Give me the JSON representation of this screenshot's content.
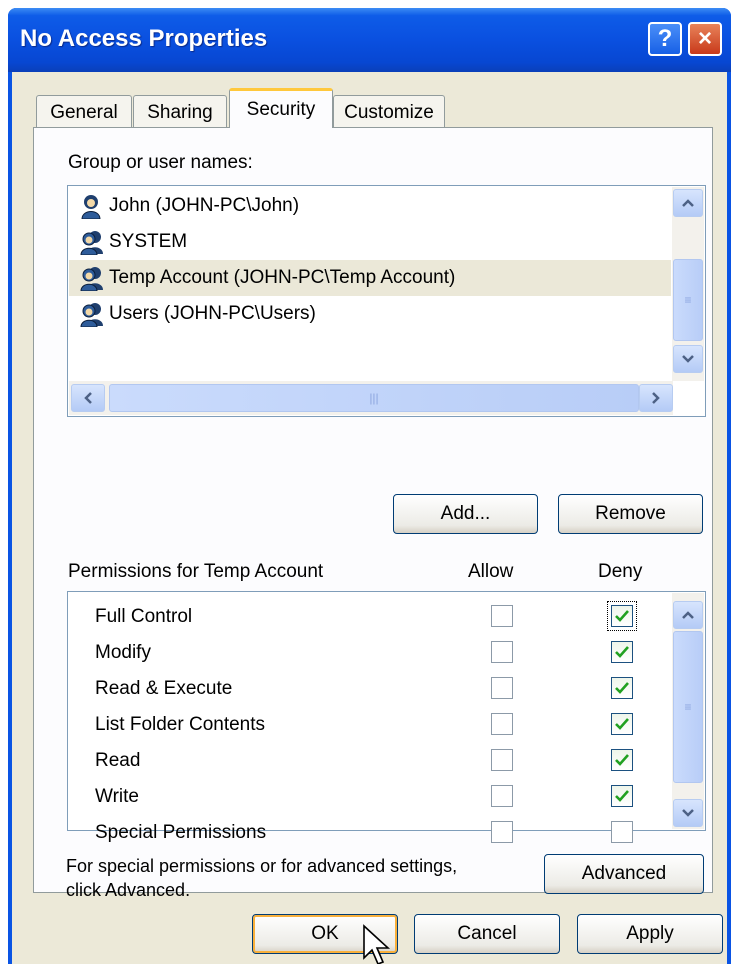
{
  "window": {
    "title": "No Access Properties",
    "help_label": "?",
    "close_label": "×"
  },
  "tabs": [
    {
      "label": "General",
      "active": false
    },
    {
      "label": "Sharing",
      "active": false
    },
    {
      "label": "Security",
      "active": true
    },
    {
      "label": "Customize",
      "active": false
    }
  ],
  "users": {
    "label": "Group or user names:",
    "items": [
      {
        "name": "John (JOHN-PC\\John)",
        "icon": "user-icon",
        "selected": false
      },
      {
        "name": "SYSTEM",
        "icon": "group-icon",
        "selected": false
      },
      {
        "name": "Temp Account (JOHN-PC\\Temp Account)",
        "icon": "group-icon",
        "selected": true
      },
      {
        "name": "Users (JOHN-PC\\Users)",
        "icon": "group-icon",
        "selected": false
      }
    ]
  },
  "buttons": {
    "add": "Add...",
    "remove": "Remove",
    "advanced": "Advanced",
    "ok": "OK",
    "cancel": "Cancel",
    "apply": "Apply"
  },
  "permissions": {
    "label": "Permissions for Temp Account",
    "allow_header": "Allow",
    "deny_header": "Deny",
    "rows": [
      {
        "name": "Full Control",
        "allow": false,
        "deny": true
      },
      {
        "name": "Modify",
        "allow": false,
        "deny": true
      },
      {
        "name": "Read & Execute",
        "allow": false,
        "deny": true
      },
      {
        "name": "List Folder Contents",
        "allow": false,
        "deny": true
      },
      {
        "name": "Read",
        "allow": false,
        "deny": true
      },
      {
        "name": "Write",
        "allow": false,
        "deny": true
      },
      {
        "name": "Special Permissions",
        "allow": false,
        "deny": false
      }
    ]
  },
  "advanced_note": {
    "line1": "For special permissions or for advanced settings,",
    "line2": "click Advanced."
  },
  "colors": {
    "title_bar": "#0a54e4",
    "dialog_bg": "#ece9d8",
    "check_green": "#21a121",
    "active_tab_accent": "#ffc83c"
  }
}
